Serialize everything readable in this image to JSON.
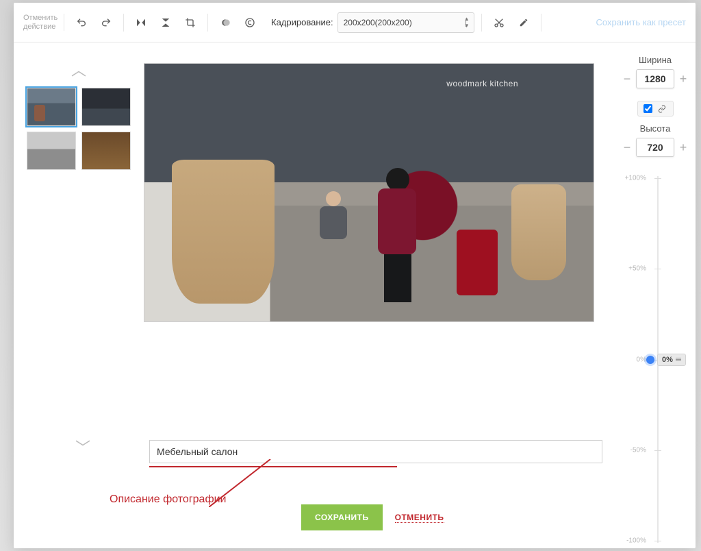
{
  "toolbar": {
    "undo_label": "Отменить действие",
    "crop_label": "Кадрирование:",
    "crop_value": "200x200(200x200)",
    "preset_link": "Сохранить как пресет"
  },
  "dimensions": {
    "width_label": "Ширина",
    "width_value": "1280",
    "height_label": "Высота",
    "height_value": "720"
  },
  "slider": {
    "ticks": [
      "+100%",
      "+50%",
      "0%",
      "-50%",
      "-100%"
    ],
    "current": "0%"
  },
  "caption": {
    "value": "Мебельный салон"
  },
  "annotation": "Описание фотографии",
  "footer": {
    "save": "СОХРАНИТЬ",
    "cancel": "ОТМЕНИТЬ"
  },
  "preview_text": "woodmark kitchen"
}
